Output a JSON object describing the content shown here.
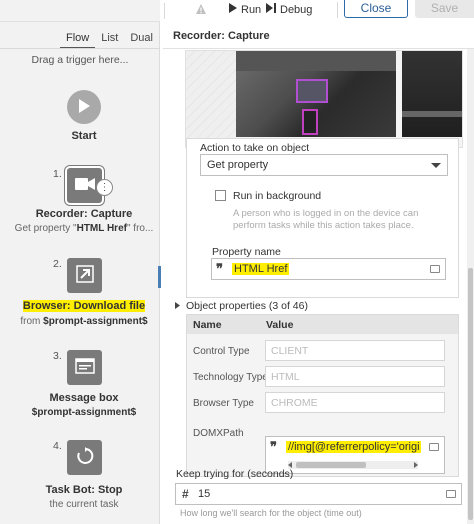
{
  "toolbar": {
    "run_label": "Run",
    "debug_label": "Debug",
    "close_label": "Close",
    "save_label": "Save"
  },
  "flow": {
    "tabs": [
      "Flow",
      "List",
      "Dual"
    ],
    "active_tab": "Flow",
    "drag_hint": "Drag a trigger here...",
    "start_label": "Start",
    "steps": [
      {
        "num": "1.",
        "title": "Recorder: Capture",
        "sub_prefix": "Get property \"",
        "sub_bold": "HTML Href",
        "sub_suffix": "\" fro...",
        "icon": "camera-icon"
      },
      {
        "num": "2.",
        "title": "Browser: Download file",
        "sub_prefix": "from ",
        "sub_bold": "$prompt-assignment$",
        "sub_suffix": "",
        "icon": "download-arrow-icon"
      },
      {
        "num": "3.",
        "title": "Message box",
        "sub_prefix": "",
        "sub_bold": "$prompt-assignment$",
        "sub_suffix": "",
        "icon": "message-box-icon"
      },
      {
        "num": "4.",
        "title": "Task Bot: Stop",
        "sub_prefix": "the current task",
        "sub_bold": "",
        "sub_suffix": "",
        "icon": "stop-refresh-icon"
      }
    ]
  },
  "details": {
    "title": "Recorder: Capture",
    "action_label": "Action to take on object",
    "action_value": "Get property",
    "run_in_background_label": "Run in background",
    "run_in_background_help": "A person who is logged in on the device can perform tasks while this action takes place.",
    "property_name_label": "Property name",
    "property_name_value": "HTML Href",
    "object_properties_label": "Object properties (3 of 46)",
    "table_headers": {
      "name": "Name",
      "value": "Value"
    },
    "properties": [
      {
        "name": "Control Type",
        "value": "CLIENT"
      },
      {
        "name": "Technology Type",
        "value": "HTML"
      },
      {
        "name": "Browser Type",
        "value": "CHROME"
      },
      {
        "name": "DOMXPath",
        "value": "//img[@referrerpolicy='origi"
      }
    ],
    "keep_trying_label": "Keep trying for (seconds)",
    "keep_trying_value": "15",
    "keep_trying_help": "How long we'll search for the object (time out)"
  },
  "colors": {
    "highlight": "#ffee00",
    "accent": "#2a6aa8",
    "node": "#7a7a7a"
  }
}
